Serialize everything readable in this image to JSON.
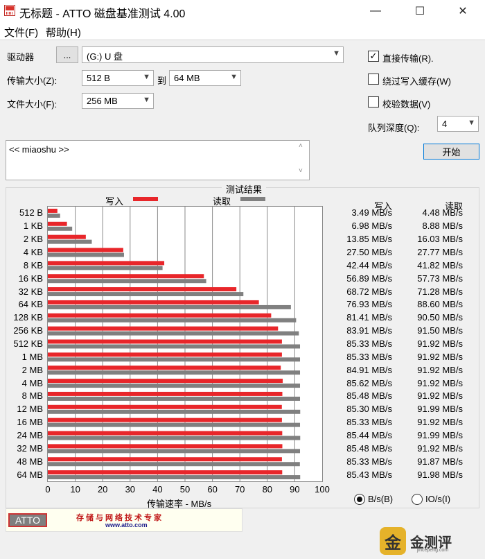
{
  "window": {
    "title": "无标题 - ATTO 磁盘基准测试 4.00",
    "minimize": "—",
    "maximize": "☐",
    "close": "✕"
  },
  "menu": [
    "文件(F)",
    "帮助(H)"
  ],
  "form": {
    "drive_label": "驱动器",
    "browse_label": "...",
    "drive_value": "(G:) U 盘",
    "transfer_label": "传输大小(Z):",
    "transfer_from": "512 B",
    "to_label": "到",
    "transfer_to": "64 MB",
    "filesize_label": "文件大小(F):",
    "filesize_value": "256 MB",
    "direct_io": {
      "label": "直接传输(R).",
      "checked": true
    },
    "bypass_cache": {
      "label": "绕过写入缓存(W)",
      "checked": false
    },
    "verify": {
      "label": "校验数据(V)",
      "checked": false
    },
    "queue_label": "队列深度(Q):",
    "queue_value": "4",
    "start_label": "开始",
    "description": "<< miaoshu >>"
  },
  "results": {
    "title": "测试结果",
    "write_label": "写入",
    "read_label": "读取",
    "col_write": "写入",
    "col_read": "读取",
    "xlabel": "传输速率 - MB/s",
    "radio_bytes": "B/s(B)",
    "radio_io": "IO/s(I)"
  },
  "chart_data": {
    "type": "bar",
    "orientation": "horizontal",
    "title": "测试结果",
    "xlabel": "传输速率 - MB/s",
    "xlim": [
      0,
      100
    ],
    "xticks": [
      "0",
      "10",
      "20",
      "30",
      "40",
      "50",
      "60",
      "70",
      "80",
      "90",
      "100"
    ],
    "grid": true,
    "legend": "top",
    "categories": [
      "512 B",
      "1 KB",
      "2 KB",
      "4 KB",
      "8 KB",
      "16 KB",
      "32 KB",
      "64 KB",
      "128 KB",
      "256 KB",
      "512 KB",
      "1 MB",
      "2 MB",
      "4 MB",
      "8 MB",
      "12 MB",
      "16 MB",
      "24 MB",
      "32 MB",
      "48 MB",
      "64 MB"
    ],
    "series": [
      {
        "name": "写入",
        "color": "#e8262a",
        "values": [
          3.49,
          6.98,
          13.85,
          27.5,
          42.44,
          56.89,
          68.72,
          76.93,
          81.41,
          83.91,
          85.33,
          85.33,
          84.91,
          85.62,
          85.48,
          85.3,
          85.33,
          85.44,
          85.48,
          85.33,
          85.43
        ],
        "labels": [
          "3.49 MB/s",
          "6.98 MB/s",
          "13.85 MB/s",
          "27.50 MB/s",
          "42.44 MB/s",
          "56.89 MB/s",
          "68.72 MB/s",
          "76.93 MB/s",
          "81.41 MB/s",
          "83.91 MB/s",
          "85.33 MB/s",
          "85.33 MB/s",
          "84.91 MB/s",
          "85.62 MB/s",
          "85.48 MB/s",
          "85.30 MB/s",
          "85.33 MB/s",
          "85.44 MB/s",
          "85.48 MB/s",
          "85.33 MB/s",
          "85.43 MB/s"
        ]
      },
      {
        "name": "读取",
        "color": "#808080",
        "values": [
          4.48,
          8.88,
          16.03,
          27.77,
          41.82,
          57.73,
          71.28,
          88.6,
          90.5,
          91.5,
          91.92,
          91.92,
          91.92,
          91.92,
          91.92,
          91.99,
          91.92,
          91.99,
          91.92,
          91.87,
          91.98
        ],
        "labels": [
          "4.48 MB/s",
          "8.88 MB/s",
          "16.03 MB/s",
          "27.77 MB/s",
          "41.82 MB/s",
          "57.73 MB/s",
          "71.28 MB/s",
          "88.60 MB/s",
          "90.50 MB/s",
          "91.50 MB/s",
          "91.92 MB/s",
          "91.92 MB/s",
          "91.92 MB/s",
          "91.92 MB/s",
          "91.92 MB/s",
          "91.99 MB/s",
          "91.92 MB/s",
          "91.99 MB/s",
          "91.92 MB/s",
          "91.87 MB/s",
          "91.98 MB/s"
        ]
      }
    ]
  },
  "banner": {
    "logo": "ATTO",
    "tagline": "存储与网络技术专家",
    "url": "www.atto.com"
  },
  "watermark": {
    "badge": "金",
    "text": "金测评",
    "sub": "jincepeng.com"
  }
}
